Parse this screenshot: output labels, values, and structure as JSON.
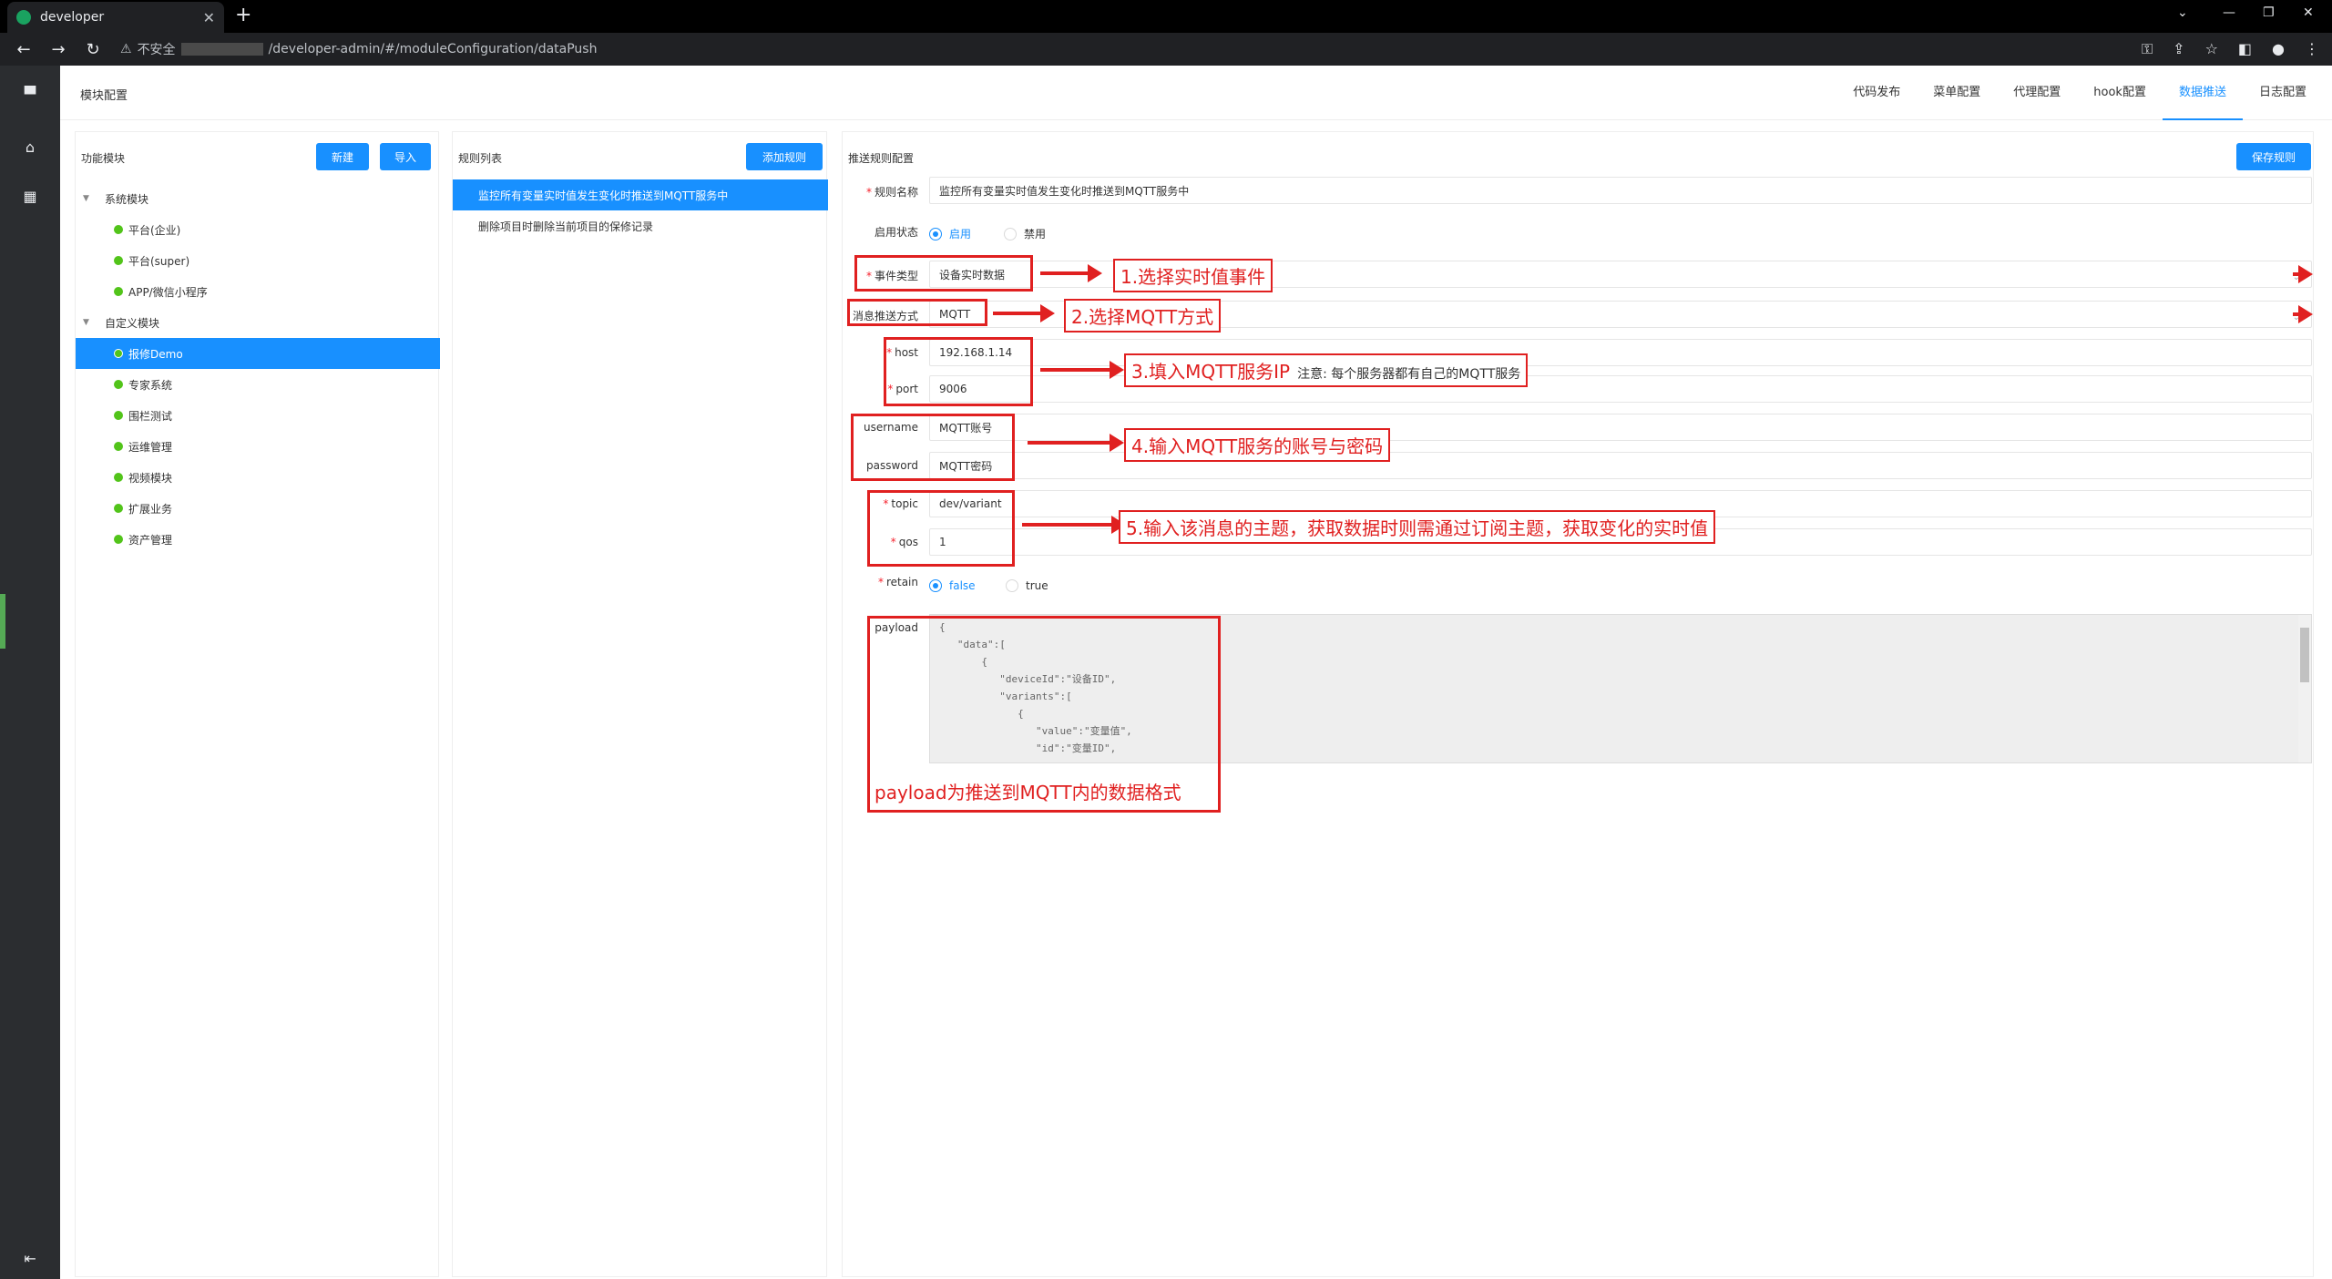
{
  "browser": {
    "tab_title": "developer",
    "security_label": "不安全",
    "url_path": "/developer-admin/#/moduleConfiguration/dataPush"
  },
  "header": {
    "title": "模块配置",
    "nav": [
      "代码发布",
      "菜单配置",
      "代理配置",
      "hook配置",
      "数据推送",
      "日志配置"
    ],
    "active_nav": "数据推送"
  },
  "modules": {
    "title": "功能模块",
    "new_button": "新建",
    "import_button": "导入",
    "groups": [
      {
        "label": "系统模块",
        "children": [
          "平台(企业)",
          "平台(super)",
          "APP/微信小程序"
        ]
      },
      {
        "label": "自定义模块",
        "children": [
          "报修Demo",
          "专家系统",
          "围栏测试",
          "运维管理",
          "视频模块",
          "扩展业务",
          "资产管理"
        ]
      }
    ],
    "selected": "报修Demo"
  },
  "rules": {
    "title": "规则列表",
    "add_button": "添加规则",
    "items": [
      "监控所有变量实时值发生变化时推送到MQTT服务中",
      "删除项目时删除当前项目的保修记录"
    ],
    "selected_index": 0
  },
  "form": {
    "title": "推送规则配置",
    "save_button": "保存规则",
    "name_label": "规则名称",
    "name_value": "监控所有变量实时值发生变化时推送到MQTT服务中",
    "status_label": "启用状态",
    "status_on": "启用",
    "status_off": "禁用",
    "event_label": "事件类型",
    "event_value": "设备实时数据",
    "method_label": "消息推送方式",
    "method_value": "MQTT",
    "host_label": "host",
    "host_value": "192.168.1.14",
    "port_label": "port",
    "port_value": "9006",
    "username_label": "username",
    "username_value": "MQTT账号",
    "password_label": "password",
    "password_value": "MQTT密码",
    "topic_label": "topic",
    "topic_value": "dev/variant",
    "qos_label": "qos",
    "qos_value": "1",
    "retain_label": "retain",
    "retain_false": "false",
    "retain_true": "true",
    "payload_label": "payload",
    "payload_code": "{\n   \"data\":[\n       {\n          \"deviceId\":\"设备ID\",\n          \"variants\":[\n             {\n                \"value\":\"变量值\",\n                \"id\":\"变量ID\","
  },
  "annotations": {
    "a1": "1.选择实时值事件",
    "a2": "2.选择MQTT方式",
    "a3": "3.填入MQTT服务IP",
    "a3_note": "注意: 每个服务器都有自己的MQTT服务",
    "a4": "4.输入MQTT服务的账号与密码",
    "a5": "5.输入该消息的主题，获取数据时则需通过订阅主题，获取变化的实时值",
    "a6": "payload为推送到MQTT内的数据格式"
  },
  "colors": {
    "accent": "#1890ff",
    "annotation": "#e02020",
    "success": "#52c41a"
  }
}
